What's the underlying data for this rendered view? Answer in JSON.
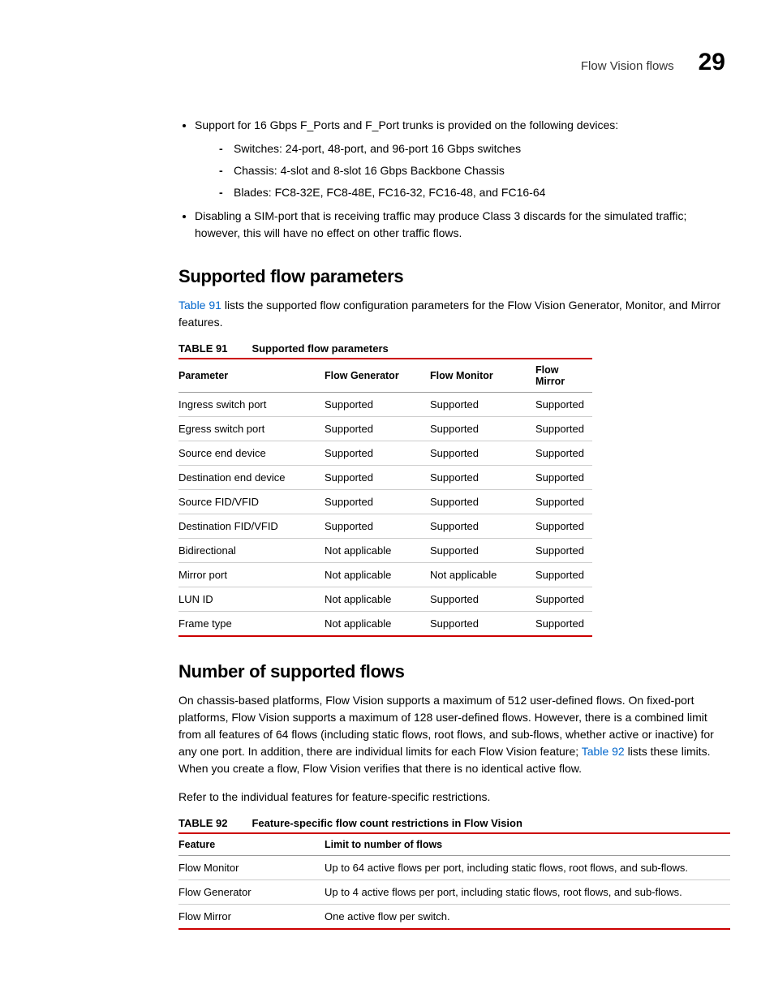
{
  "header": {
    "title": "Flow Vision flows",
    "chapter": "29"
  },
  "bullets": {
    "item1": "Support for 16 Gbps F_Ports and F_Port trunks is provided on the following devices:",
    "sub1": "Switches: 24-port, 48-port, and 96-port 16 Gbps switches",
    "sub2": "Chassis: 4-slot and 8-slot 16 Gbps Backbone Chassis",
    "sub3": "Blades: FC8-32E, FC8-48E, FC16-32, FC16-48, and FC16-64",
    "item2": "Disabling a SIM-port that is receiving traffic may produce Class 3 discards for the simulated traffic; however, this will have no effect on other traffic flows."
  },
  "section1": {
    "heading": "Supported flow parameters",
    "para_link": "Table 91",
    "para_rest": " lists the supported flow configuration parameters for the Flow Vision Generator, Monitor, and Mirror features."
  },
  "table91": {
    "label_num": "TABLE 91",
    "label_title": "Supported flow parameters",
    "headers": {
      "h0": "Parameter",
      "h1": "Flow Generator",
      "h2": "Flow Monitor",
      "h3": "Flow Mirror"
    },
    "rows": [
      {
        "c0": "Ingress switch port",
        "c1": "Supported",
        "c2": "Supported",
        "c3": "Supported"
      },
      {
        "c0": "Egress switch port",
        "c1": "Supported",
        "c2": "Supported",
        "c3": "Supported"
      },
      {
        "c0": "Source end device",
        "c1": "Supported",
        "c2": "Supported",
        "c3": "Supported"
      },
      {
        "c0": "Destination end device",
        "c1": "Supported",
        "c2": "Supported",
        "c3": "Supported"
      },
      {
        "c0": "Source FID/VFID",
        "c1": "Supported",
        "c2": "Supported",
        "c3": "Supported"
      },
      {
        "c0": "Destination FID/VFID",
        "c1": "Supported",
        "c2": "Supported",
        "c3": "Supported"
      },
      {
        "c0": "Bidirectional",
        "c1": "Not applicable",
        "c2": "Supported",
        "c3": "Supported"
      },
      {
        "c0": "Mirror port",
        "c1": "Not applicable",
        "c2": "Not applicable",
        "c3": "Supported"
      },
      {
        "c0": "LUN ID",
        "c1": "Not applicable",
        "c2": "Supported",
        "c3": "Supported"
      },
      {
        "c0": "Frame type",
        "c1": "Not applicable",
        "c2": "Supported",
        "c3": "Supported"
      }
    ]
  },
  "section2": {
    "heading": "Number of supported flows",
    "para1_a": "On chassis-based platforms, Flow Vision supports a maximum of 512 user-defined flows. On fixed-port platforms, Flow Vision supports a maximum of 128 user-defined flows. However, there is a combined limit from all features of 64 flows (including static flows, root flows, and sub-flows, whether active or inactive) for any one port. In addition, there are individual limits for each Flow Vision feature; ",
    "para1_link": "Table 92",
    "para1_b": " lists these limits. When you create a flow, Flow Vision verifies that there is no identical active flow.",
    "para2": "Refer to the individual features for feature-specific restrictions."
  },
  "table92": {
    "label_num": "TABLE 92",
    "label_title": "Feature-specific flow count restrictions in Flow Vision",
    "headers": {
      "h0": "Feature",
      "h1": "Limit to number of flows"
    },
    "rows": [
      {
        "c0": "Flow Monitor",
        "c1": "Up to 64 active flows per port, including static flows, root flows, and sub-flows."
      },
      {
        "c0": "Flow Generator",
        "c1": "Up to 4 active flows per port, including static flows, root flows, and sub-flows."
      },
      {
        "c0": "Flow Mirror",
        "c1": "One active flow per switch."
      }
    ]
  }
}
